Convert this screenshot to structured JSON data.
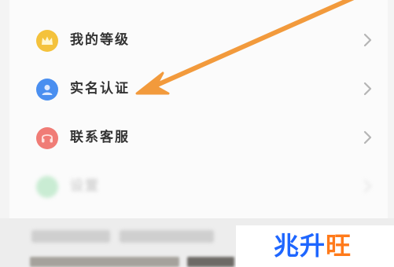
{
  "menu": {
    "items": [
      {
        "label": "我的等级",
        "icon": "crown-icon",
        "icon_color": "#f4c23c"
      },
      {
        "label": "实名认证",
        "icon": "user-badge-icon",
        "icon_color": "#4a8ff0"
      },
      {
        "label": "联系客服",
        "icon": "headset-icon",
        "icon_color": "#f07c76"
      },
      {
        "label": "设置",
        "icon": "settings-icon",
        "icon_color": "#c9ecd3"
      }
    ]
  },
  "annotation": {
    "color": "#f29a3c"
  },
  "watermark": {
    "text": "兆升旺",
    "highlight": "旺"
  }
}
